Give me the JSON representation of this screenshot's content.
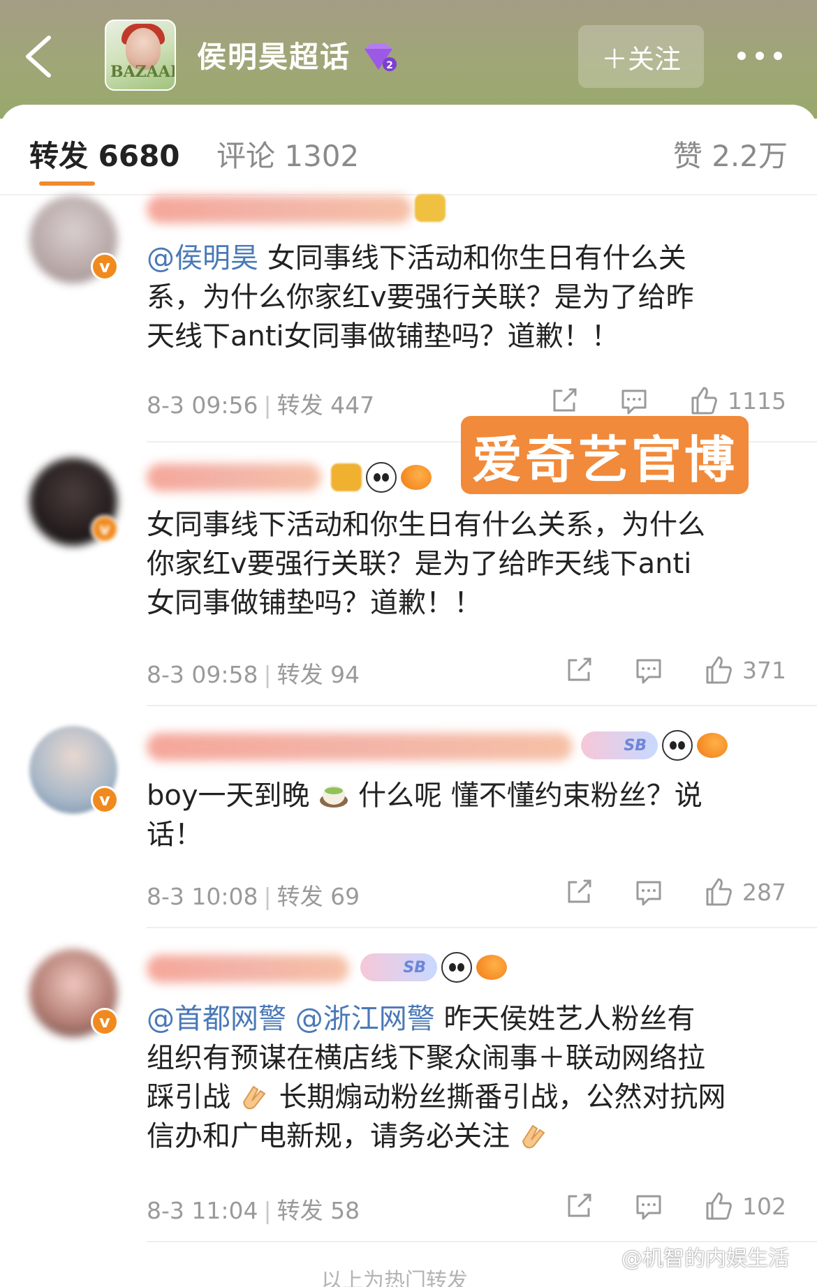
{
  "header": {
    "topic_title": "侯明昊超话",
    "follow_label": "＋关注",
    "cover_text": "BAZAAR"
  },
  "tabs": {
    "repost": "转发 6680",
    "comment": "评论 1302",
    "like": "赞 2.2万"
  },
  "overlay_label": "爱奇艺官博",
  "posts": [
    {
      "mentions": [
        "@侯明昊"
      ],
      "text": "女同事线下活动和你生日有什么关系，为什么你家红v要强行关联？是为了给昨天线下anti女同事做铺垫吗？道歉！！",
      "line1": "女同事线下活动和你生日有什么关",
      "line2": "系，为什么你家红v要强行关联？是为了给昨",
      "line3": "天线下anti女同事做铺垫吗？道歉！！",
      "time": "8-3 09:56",
      "repost": "转发 447",
      "likes": "1115"
    },
    {
      "line1": "女同事线下活动和你生日有什么关系，为什么",
      "line2": "你家红v要强行关联？是为了给昨天线下anti",
      "line3": "女同事做铺垫吗？道歉！！",
      "time": "8-3 09:58",
      "repost": "转发 94",
      "likes": "371"
    },
    {
      "line1_a": "boy一天到晚",
      "line1_b": "什么呢 懂不懂约束粉丝？说",
      "line2": "话！",
      "time": "8-3 10:08",
      "repost": "转发 69",
      "likes": "287",
      "badge": "SB"
    },
    {
      "mention1": "@首都网警",
      "mention2": "@浙江网警",
      "line1": "昨天侯姓艺人粉丝有",
      "line2": "组织有预谋在横店线下聚众闹事＋联动网络拉",
      "line3_a": "踩引战",
      "line3_b": "长期煽动粉丝撕番引战，公然对抗网",
      "line4": "信办和广电新规，请务必关注",
      "time": "8-3 11:04",
      "repost": "转发 58",
      "likes": "102",
      "badge": "SB"
    }
  ],
  "footer_hint": "以上为热门转发",
  "watermark": "@机智的内娱生活",
  "colors": {
    "accent": "#f08a2e",
    "mention": "#4a79b7",
    "header_green": "#9fa776",
    "overlay_orange": "#f18a3a"
  }
}
